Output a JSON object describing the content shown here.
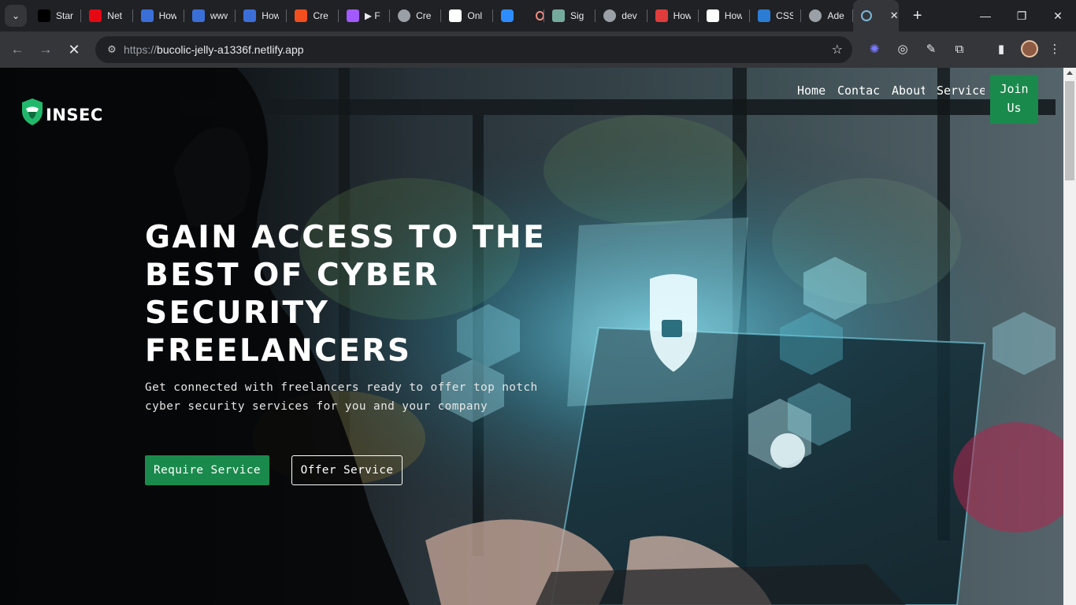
{
  "browser": {
    "tabs": [
      {
        "title": "Star",
        "icon": "x-icon",
        "color": "#000000"
      },
      {
        "title": "Net",
        "icon": "netflix-icon",
        "color": "#e50914"
      },
      {
        "title": "How",
        "icon": "bookmark-icon",
        "color": "#3b6fd8"
      },
      {
        "title": "www",
        "icon": "bookmark-icon",
        "color": "#3b6fd8"
      },
      {
        "title": "How",
        "icon": "bookmark-icon",
        "color": "#3b6fd8"
      },
      {
        "title": "Cre",
        "icon": "figma-icon",
        "color": "#f24e1e"
      },
      {
        "title": "▶ F",
        "icon": "figma-icon",
        "color": "#a259ff"
      },
      {
        "title": "Cre",
        "icon": "globe-icon",
        "color": "#9aa0a6"
      },
      {
        "title": "Onl",
        "icon": "vimeo-icon",
        "color": "#ffffff"
      },
      {
        "title": "",
        "icon": "zoom-icon",
        "color": "#2d8cff"
      },
      {
        "title": "Sig",
        "icon": "openai-icon",
        "color": "#74aa9c"
      },
      {
        "title": "dev",
        "icon": "chrome-icon",
        "color": "#9aa0a6"
      },
      {
        "title": "How",
        "icon": "s-icon",
        "color": "#e03c3c"
      },
      {
        "title": "How",
        "icon": "hex-icon",
        "color": "#ffffff"
      },
      {
        "title": "CSS",
        "icon": "edge-icon",
        "color": "#2b7cd3"
      },
      {
        "title": "Ade",
        "icon": "globe-icon",
        "color": "#9aa0a6"
      }
    ],
    "active_tab_close": "✕",
    "new_tab": "+",
    "url_scheme": "https://",
    "url_host": "bucolic-jelly-a1336f.netlify.app"
  },
  "site": {
    "brand": "INSEC",
    "nav": {
      "home": "Home",
      "contact": "Contact",
      "about": "About",
      "service": "Services",
      "join": "Join Us"
    },
    "hero": {
      "headline": "Gain access to the best of cyber security freelancers",
      "subtitle": "Get connected with freelancers ready to offer top notch cyber security services for you and your company",
      "require_button": "Require Service",
      "offer_button": "Offer Service"
    },
    "colors": {
      "accent": "#1a8a4c",
      "text": "#ffffff"
    }
  }
}
